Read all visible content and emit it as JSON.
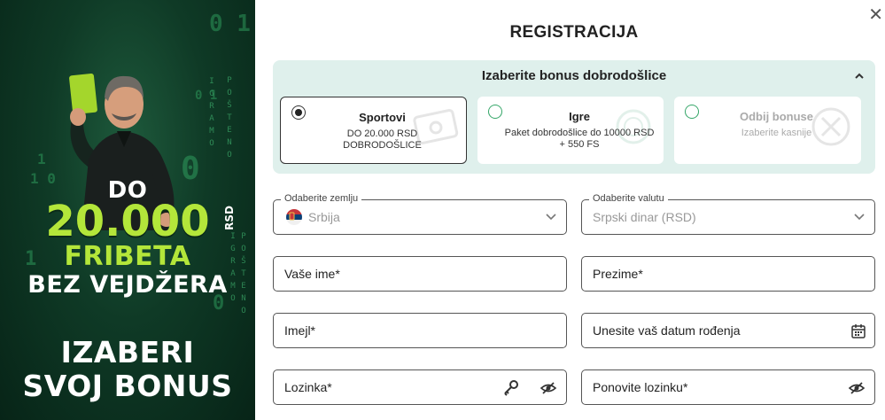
{
  "promo": {
    "do": "DO",
    "amount": "20.000",
    "currency": "RSD",
    "fribeta": "FRIBETA",
    "bez_vejdzera": "BEZ VEJDŽERA",
    "izaberi": "IZABERI",
    "svoj_bonus": "SVOJ BONUS",
    "vertical_text_1": "IGRAMO",
    "vertical_text_2": "POŠTENO",
    "digits": [
      "0 1",
      "1",
      "0",
      "1 0",
      "0 1",
      "1",
      "0"
    ]
  },
  "dialog": {
    "title": "REGISTRACIJA",
    "close_icon": "close-icon"
  },
  "bonus": {
    "title": "Izaberite bonus dobrodošlice",
    "options": [
      {
        "title": "Sportovi",
        "desc": "DO 20.000 RSD DOBRODOŠLICE",
        "selected": true
      },
      {
        "title": "Igre",
        "desc": "Paket dobrodošlice do 10000 RSD + 550 FS",
        "selected": false
      },
      {
        "title": "Odbij bonuse",
        "desc": "Izaberite kasnije",
        "selected": false
      }
    ]
  },
  "form": {
    "country": {
      "label": "Odaberite zemlju",
      "value": "Srbija"
    },
    "currency": {
      "label": "Odaberite valutu",
      "value": "Srpski dinar (RSD)"
    },
    "first_name": {
      "placeholder": "Vaše ime*"
    },
    "last_name": {
      "placeholder": "Prezime*"
    },
    "email": {
      "placeholder": "Imejl*"
    },
    "birthdate": {
      "placeholder": "Unesite vaš datum rođenja"
    },
    "password": {
      "placeholder": "Lozinka*"
    },
    "password_repeat": {
      "placeholder": "Ponovite lozinku*"
    }
  },
  "colors": {
    "accent_lime": "#b4e63a",
    "bonus_bg": "#dff0ec",
    "promo_green": "#0f3a26"
  }
}
